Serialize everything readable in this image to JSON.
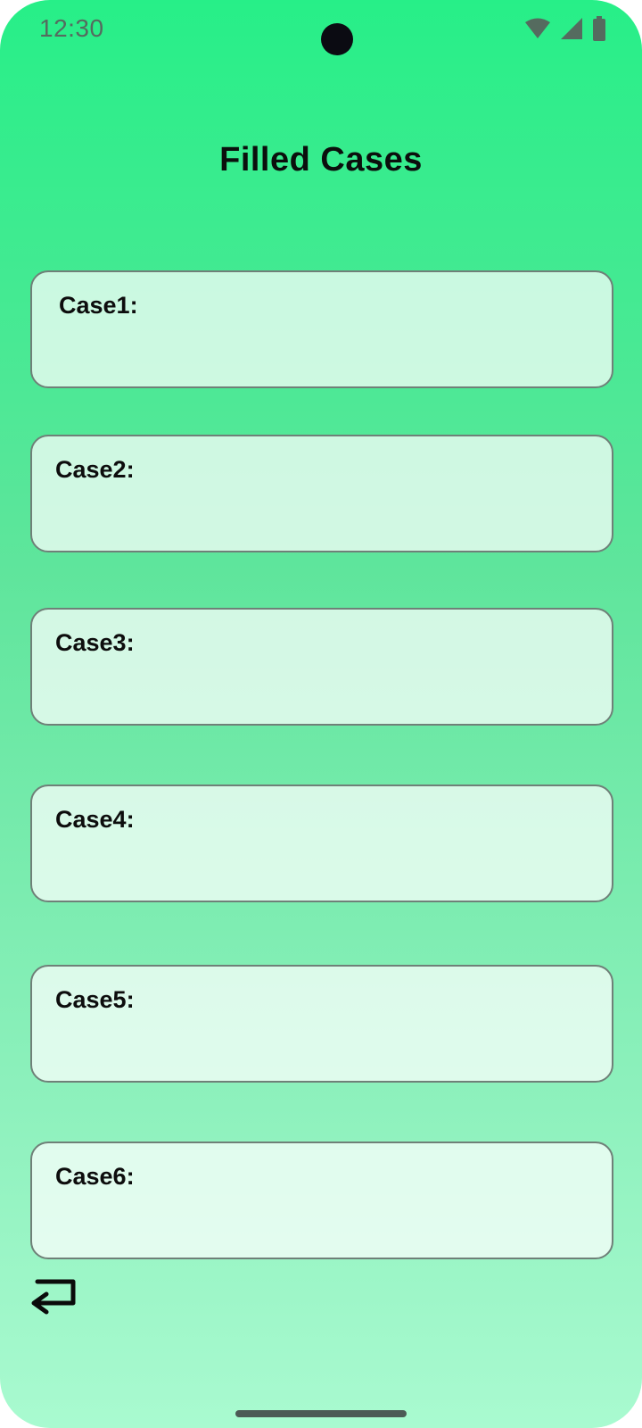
{
  "status_bar": {
    "time": "12:30",
    "icons": [
      "wifi-icon",
      "cellular-signal-icon",
      "battery-icon"
    ]
  },
  "header": {
    "title": "Filled Cases"
  },
  "cases": [
    {
      "label": "Case1:"
    },
    {
      "label": "Case2:"
    },
    {
      "label": "Case3:"
    },
    {
      "label": "Case4:"
    },
    {
      "label": "Case5:"
    },
    {
      "label": "Case6:"
    }
  ],
  "footer": {
    "back_icon": "return-arrow-icon"
  },
  "colors": {
    "gradient_top": "#27ef88",
    "gradient_bottom": "#a9fad0",
    "card_border": "#6f8078",
    "text": "#0d0d0d"
  }
}
